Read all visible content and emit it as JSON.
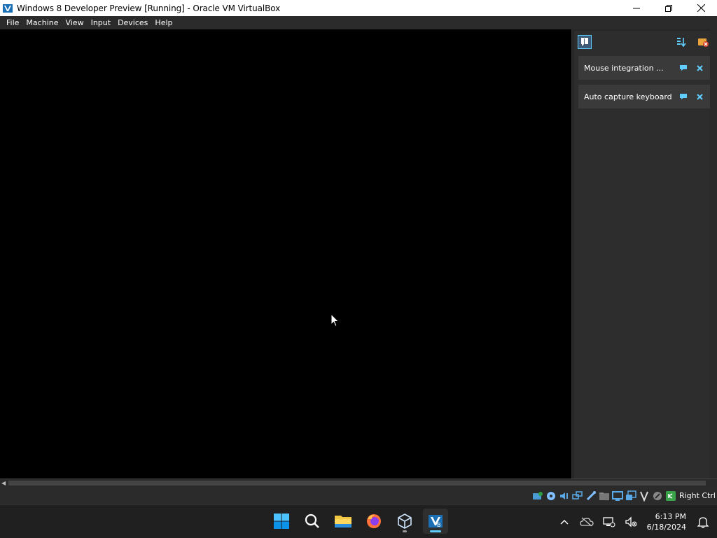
{
  "window": {
    "title": "Windows 8 Developer Preview [Running] - Oracle VM VirtualBox"
  },
  "menu": {
    "items": [
      "File",
      "Machine",
      "View",
      "Input",
      "Devices",
      "Help"
    ]
  },
  "notification_pane": {
    "notifications": [
      {
        "text": "Mouse integration ..."
      },
      {
        "text": "Auto capture keyboard ..."
      }
    ]
  },
  "statusbar": {
    "host_key": "Right Ctrl",
    "icons": [
      "hard-disk-icon",
      "optical-drive-icon",
      "audio-icon",
      "network-icon",
      "usb-icon",
      "shared-folders-icon",
      "display-icon",
      "recording-icon",
      "cpu-icon",
      "mouse-integration-icon",
      "keyboard-capture-icon"
    ]
  },
  "taskbar": {
    "apps": [
      "start-icon",
      "search-icon",
      "file-explorer-icon",
      "firefox-icon",
      "virtualbox-manager-icon",
      "virtualbox-vm-icon"
    ]
  },
  "tray": {
    "time": "6:13 PM",
    "date": "6/18/2024"
  },
  "colors": {
    "accent": "#60cdff",
    "vm_background": "#000000",
    "pane_background": "#2d2d2d",
    "notification_bg": "#3a3a3a"
  }
}
